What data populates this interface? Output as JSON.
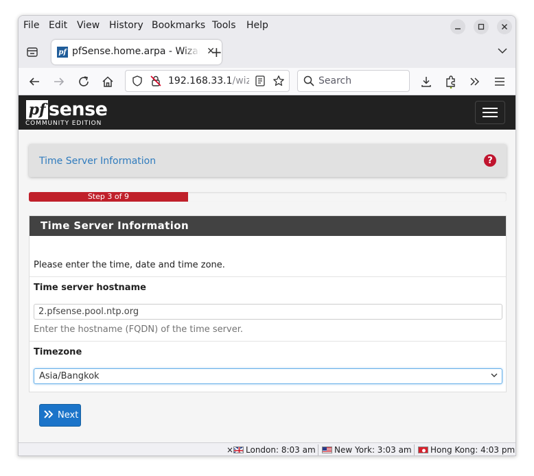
{
  "browser": {
    "menu": [
      "File",
      "Edit",
      "View",
      "History",
      "Bookmarks",
      "Tools",
      "Help"
    ],
    "tab_title": "pfSense.home.arpa - Wizard",
    "url_host": "192.168.33.1",
    "url_path": "/wiz",
    "search_placeholder": "Search",
    "new_tab_symbol": "+",
    "close_symbol": "✕"
  },
  "pfsense": {
    "logo_main": "sense",
    "logo_prefix": "pf",
    "logo_sub": "COMMUNITY EDITION",
    "page_title": "Time Server Information",
    "help_symbol": "?",
    "progress": {
      "label": "Step 3 of 9",
      "fraction": 0.333
    },
    "form": {
      "title": "Time Server Information",
      "intro": "Please enter the time, date and time zone.",
      "hostname_label": "Time server hostname",
      "hostname_value": "2.pfsense.pool.ntp.org",
      "hostname_help": "Enter the hostname (FQDN) of the time server.",
      "timezone_label": "Timezone",
      "timezone_value": "Asia/Bangkok"
    },
    "next_label": "Next"
  },
  "status": {
    "close_symbol": "×",
    "clocks": [
      {
        "city": "London: 8:03 am"
      },
      {
        "city": "New York: 3:03 am"
      },
      {
        "city": "Hong Kong: 4:03 pm"
      }
    ]
  },
  "colors": {
    "progress_fill": "#c0202a",
    "next_button": "#1b74c9",
    "header_bg": "#212121",
    "link_blue": "#2f7bbd"
  }
}
